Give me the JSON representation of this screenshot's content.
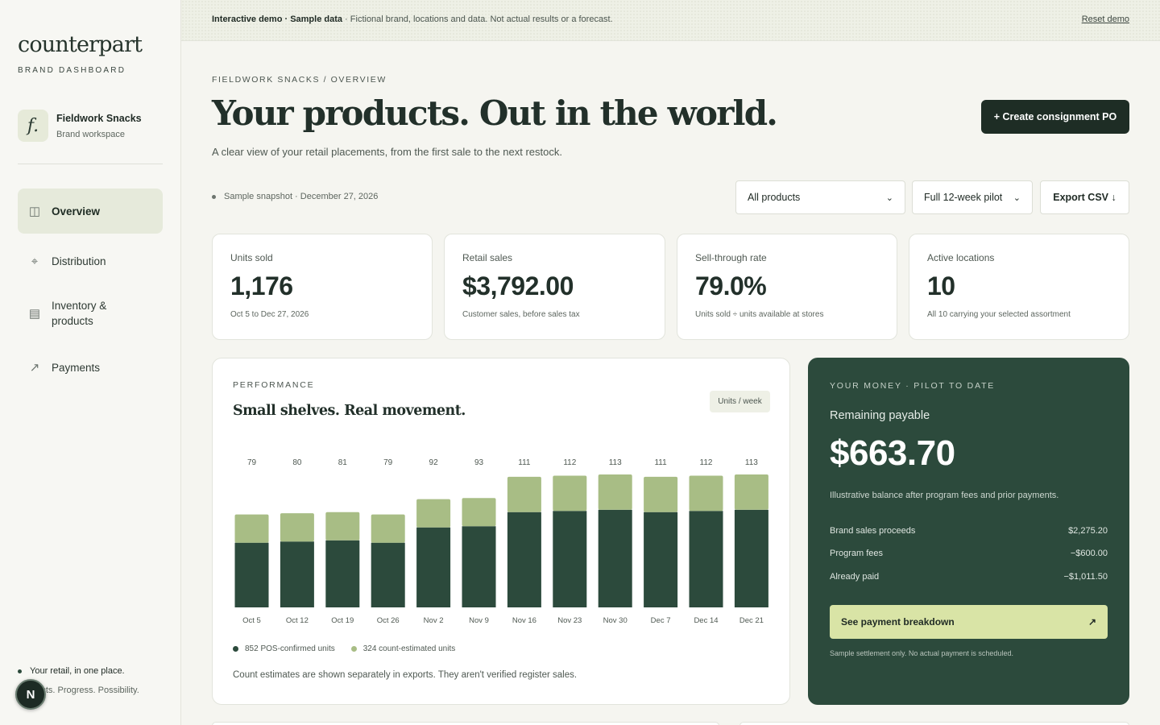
{
  "sidebar": {
    "logo": "counterpart",
    "logo_sub": "BRAND DASHBOARD",
    "workspace": {
      "initial": "f.",
      "name": "Fieldwork Snacks",
      "sub": "Brand workspace"
    },
    "nav": [
      {
        "label": "Overview",
        "icon": "columns-icon",
        "glyph": "◫",
        "active": true
      },
      {
        "label": "Distribution",
        "icon": "crosshair-icon",
        "glyph": "⌖",
        "active": false
      },
      {
        "label": "Inventory & products",
        "icon": "inventory-icon",
        "glyph": "▤",
        "active": false
      },
      {
        "label": "Payments",
        "icon": "arrow-up-right-icon",
        "glyph": "↗",
        "active": false
      }
    ],
    "tagline": "Your retail, in one place.",
    "tagline2": "Products. Progress. Possibility.",
    "badge": "N"
  },
  "banner": {
    "strong": "Interactive demo · Sample data",
    "text": " · Fictional brand, locations and data. Not actual results or a forecast.",
    "reset": "Reset demo"
  },
  "header": {
    "breadcrumb": "FIELDWORK SNACKS / OVERVIEW",
    "title": "Your products. Out in the world.",
    "subtitle": "A clear view of your retail placements, from the first sale to the next restock.",
    "create_button": "+ Create consignment PO",
    "snapshot": "Sample snapshot · December 27, 2026",
    "product_filter": "All products",
    "period_filter": "Full 12-week pilot",
    "export_button": "Export CSV ↓"
  },
  "kpis": [
    {
      "label": "Units sold",
      "value": "1,176",
      "note": "Oct 5 to Dec 27, 2026"
    },
    {
      "label": "Retail sales",
      "value": "$3,792.00",
      "note": "Customer sales, before sales tax"
    },
    {
      "label": "Sell-through rate",
      "value": "79.0%",
      "note": "Units sold ÷ units available at stores"
    },
    {
      "label": "Active locations",
      "value": "10",
      "note": "All 10 carrying your selected assortment"
    }
  ],
  "performance": {
    "eyebrow": "PERFORMANCE",
    "title": "Small shelves. Real movement.",
    "unit_pill": "Units / week",
    "legend_pos": "852 POS-confirmed units",
    "legend_est": "324 count-estimated units",
    "footnote": "Count estimates are shown separately in exports. They aren't verified register sales."
  },
  "chart_data": {
    "type": "bar",
    "stacked": true,
    "categories": [
      "Oct 5",
      "Oct 12",
      "Oct 19",
      "Oct 26",
      "Nov 2",
      "Nov 9",
      "Nov 16",
      "Nov 23",
      "Nov 30",
      "Dec 7",
      "Dec 14",
      "Dec 21"
    ],
    "totals": [
      79,
      80,
      81,
      79,
      92,
      93,
      111,
      112,
      113,
      111,
      112,
      113
    ],
    "series": [
      {
        "name": "852 POS-confirmed units",
        "color": "#2c4a3c",
        "values": [
          55,
          56,
          57,
          55,
          68,
          69,
          81,
          82,
          83,
          81,
          82,
          83
        ]
      },
      {
        "name": "324 count-estimated units",
        "color": "#a8bd85",
        "values": [
          24,
          24,
          24,
          24,
          24,
          24,
          30,
          30,
          30,
          30,
          30,
          30
        ]
      }
    ],
    "ylim": [
      0,
      113
    ],
    "grid": false,
    "legend": "bottom-left"
  },
  "money": {
    "eyebrow": "YOUR MONEY · PILOT TO DATE",
    "label": "Remaining payable",
    "value": "$663.70",
    "description": "Illustrative balance after program fees and prior payments.",
    "rows": [
      {
        "label": "Brand sales proceeds",
        "value": "$2,275.20"
      },
      {
        "label": "Program fees",
        "value": "−$600.00"
      },
      {
        "label": "Already paid",
        "value": "−$1,011.50"
      }
    ],
    "button": "See payment breakdown",
    "button_icon": "↗",
    "fine_print": "Sample settlement only. No actual payment is scheduled."
  }
}
